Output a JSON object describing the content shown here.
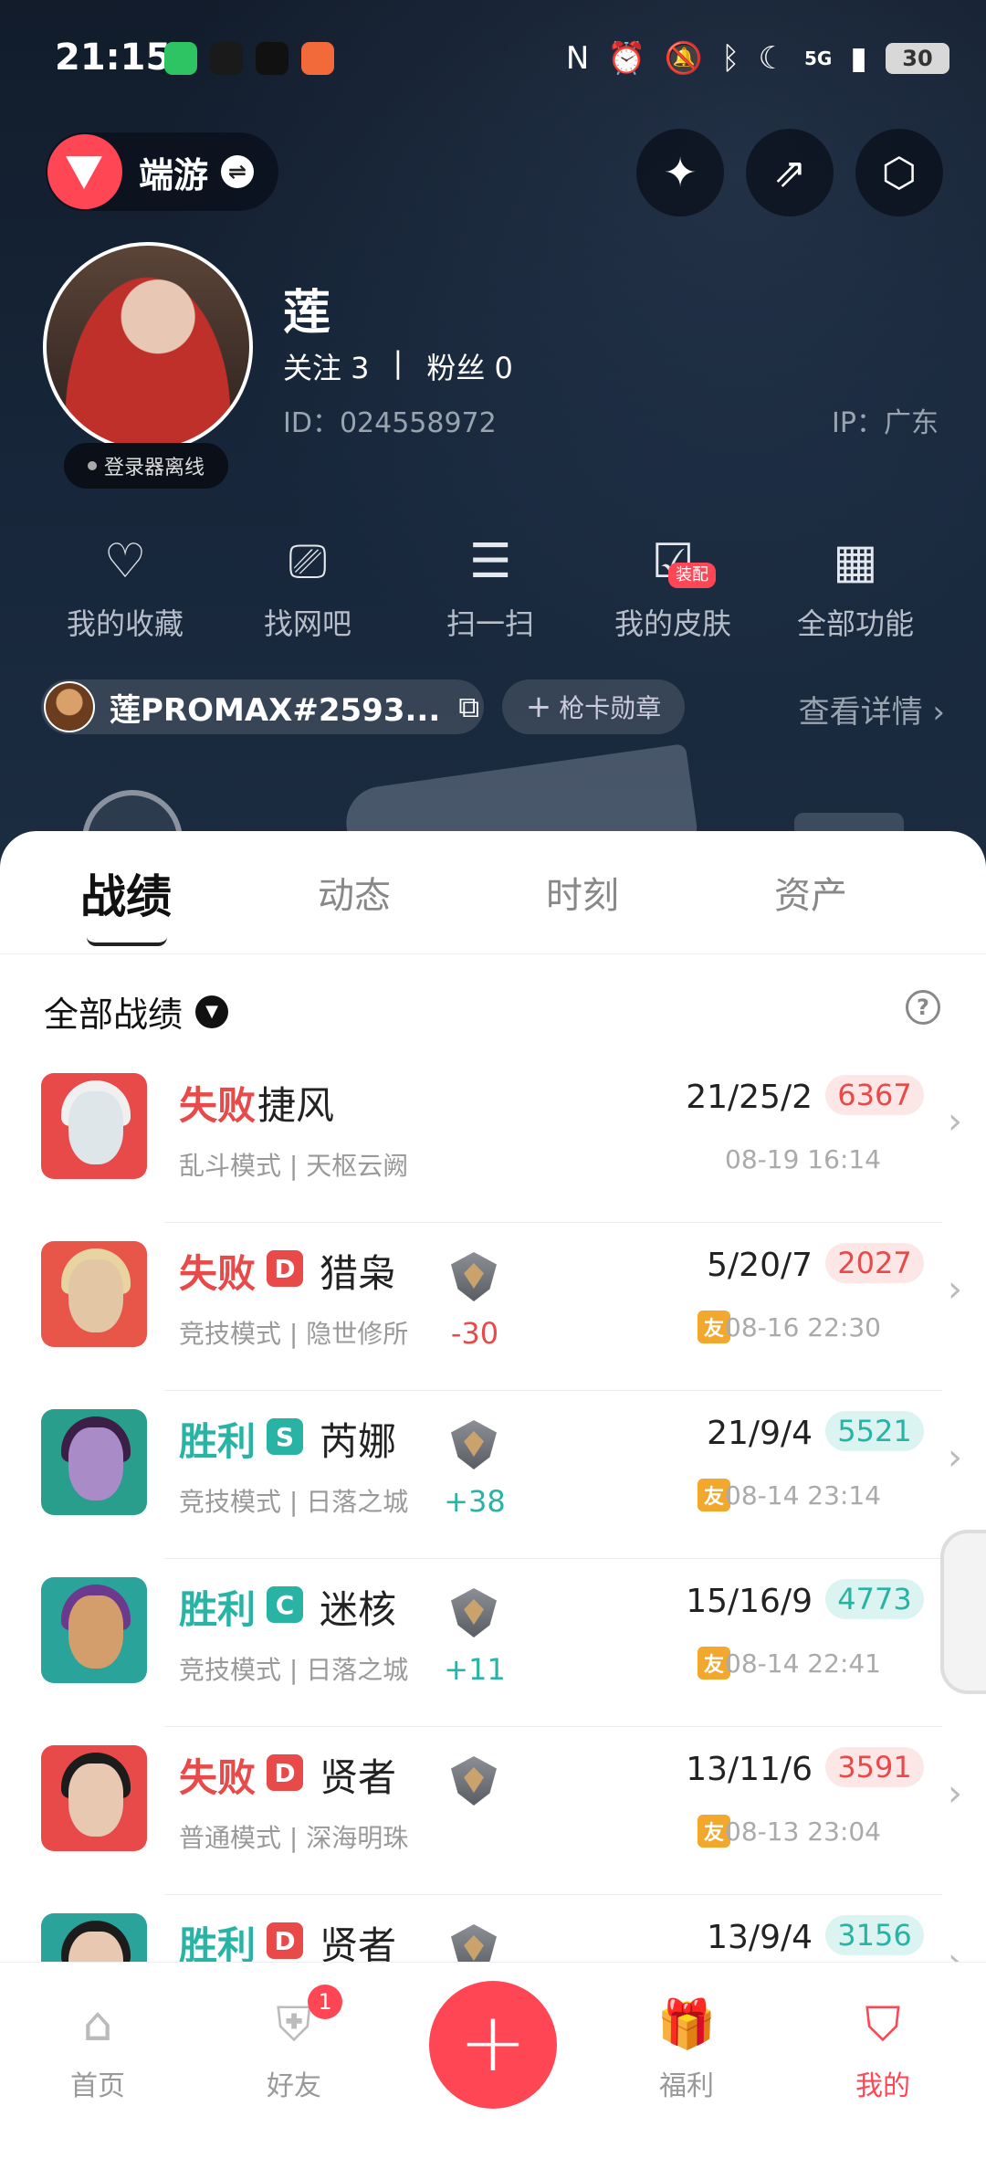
{
  "status_bar": {
    "time": "21:15",
    "apps": [
      {
        "name": "wechat-icon",
        "color": "#2ec464"
      },
      {
        "name": "qq-icon",
        "color": "#1a1a1a"
      },
      {
        "name": "douyin-icon",
        "color": "#111111"
      },
      {
        "name": "photo-app-icon",
        "color": "#f26a3a"
      }
    ],
    "network": "5G",
    "battery": "30"
  },
  "header": {
    "game_name": "端游",
    "swap_icon": "⇌"
  },
  "profile": {
    "nickname": "莲",
    "following": "关注 3",
    "separator": "|",
    "fans": "粉丝 0",
    "id_text": "ID：024558972",
    "ip_text": "IP：广东",
    "online_status": "登录器离线"
  },
  "quick_actions": [
    {
      "icon": "heart-icon",
      "glyph": "♡",
      "label": "我的收藏"
    },
    {
      "icon": "monitor-icon",
      "glyph": "⎚",
      "label": "找网吧"
    },
    {
      "icon": "scan-icon",
      "glyph": "☰",
      "label": "扫一扫"
    },
    {
      "icon": "skin-icon",
      "glyph": "☑",
      "label": "我的皮肤",
      "tag": "装配"
    },
    {
      "icon": "grid-icon",
      "glyph": "▦",
      "label": "全部功能"
    }
  ],
  "account": {
    "game_id": "莲PROMAX#2593...",
    "medal_label": "枪卡勋章",
    "detail_link": "查看详情 ›"
  },
  "tabs": [
    "战绩",
    "动态",
    "时刻",
    "资产"
  ],
  "filter": {
    "label": "全部战绩",
    "help": "?"
  },
  "matches": [
    {
      "result": "失败",
      "outcome": "loss",
      "rank_letter": "",
      "agent": "捷风",
      "mode": "乱斗模式 | 天枢云阙",
      "rr": "",
      "kda": "21/25/2",
      "score": "6367",
      "friend": false,
      "date": "08-19 16:14",
      "art": [
        "#e84a4a",
        "#dfe6ea",
        "#f0f0f0"
      ]
    },
    {
      "result": "失败",
      "outcome": "loss",
      "rank_letter": "D",
      "agent": "猎枭",
      "mode": "竞技模式 | 隐世修所",
      "rr": "-30",
      "kda": "5/20/7",
      "score": "2027",
      "friend": true,
      "date": "08-16 22:30",
      "art": [
        "#e8564a",
        "#e3c7a5",
        "#e9d3a0"
      ]
    },
    {
      "result": "胜利",
      "outcome": "win",
      "rank_letter": "S",
      "agent": "芮娜",
      "mode": "竞技模式 | 日落之城",
      "rr": "+38",
      "kda": "21/9/4",
      "score": "5521",
      "friend": true,
      "date": "08-14 23:14",
      "art": [
        "#2a9e8c",
        "#a98bc7",
        "#3b1f47"
      ]
    },
    {
      "result": "胜利",
      "outcome": "win",
      "rank_letter": "C",
      "agent": "迷核",
      "mode": "竞技模式 | 日落之城",
      "rr": "+11",
      "kda": "15/16/9",
      "score": "4773",
      "friend": true,
      "date": "08-14 22:41",
      "art": [
        "#2aa39a",
        "#d49e6c",
        "#6b3a8c"
      ]
    },
    {
      "result": "失败",
      "outcome": "loss",
      "rank_letter": "D",
      "agent": "贤者",
      "mode": "普通模式 | 深海明珠",
      "rr": "",
      "kda": "13/11/6",
      "score": "3591",
      "friend": true,
      "date": "08-13 23:04",
      "art": [
        "#e84a4a",
        "#e8c8b0",
        "#1c1c1c"
      ]
    },
    {
      "result": "胜利",
      "outcome": "win",
      "rank_letter": "D",
      "agent": "贤者",
      "mode": "",
      "rr": "",
      "kda": "13/9/4",
      "score": "3156",
      "friend": false,
      "date": "",
      "art": [
        "#2aa39a",
        "#e8c8b0",
        "#1c1c1c"
      ]
    }
  ],
  "bottom_nav": [
    {
      "label": "首页",
      "icon": "home-icon",
      "glyph": "⌂"
    },
    {
      "label": "好友",
      "icon": "friends-icon",
      "glyph": "⛨",
      "badge": "1"
    },
    {
      "label": "",
      "icon": "plus-icon",
      "glyph": "+"
    },
    {
      "label": "福利",
      "icon": "gift-icon",
      "glyph": "🎁"
    },
    {
      "label": "我的",
      "icon": "profile-icon",
      "glyph": "⛉"
    }
  ],
  "colors": {
    "accent": "#ff4655",
    "win": "#28b3a5",
    "loss": "#e84a4a",
    "rank_d": "#e84a4a",
    "rank_s": "#28b3a5",
    "rank_c": "#28b3a5",
    "friend_tag": "#f1a82d"
  }
}
